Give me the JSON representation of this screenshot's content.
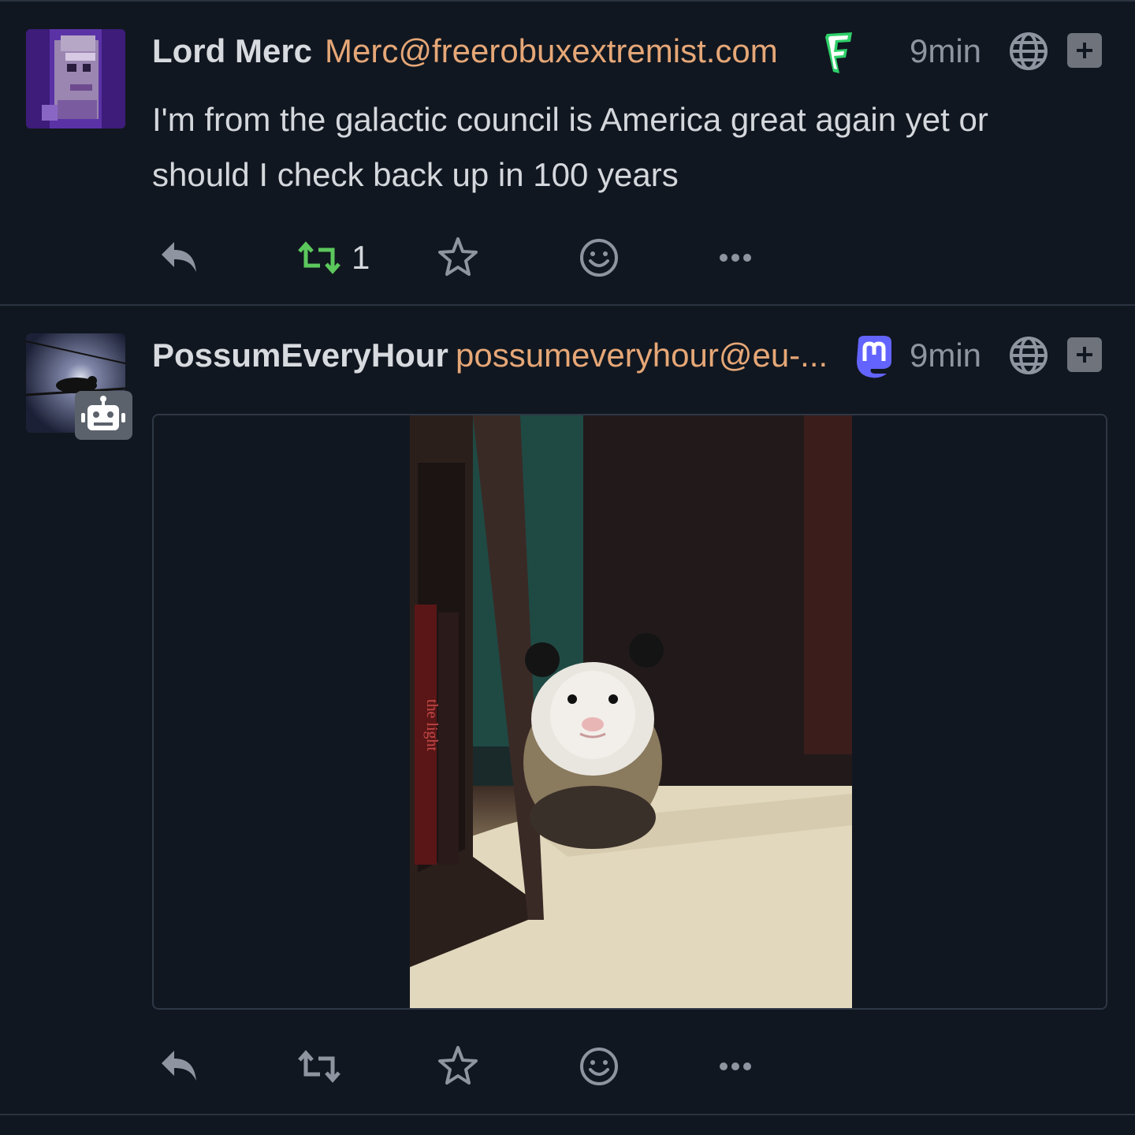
{
  "posts": [
    {
      "display_name": "Lord Merc",
      "handle": "Merc@freerobuxextremist.com",
      "server_icon": "fedi-f-logo-icon",
      "timestamp": "9min",
      "visibility_icon": "globe-icon",
      "content": "I'm from the galactic council is America great again yet or should I check back up in 100 years",
      "boost_count": "1",
      "boosted": true,
      "accent_boost_color": "#5cc85c"
    },
    {
      "display_name": "PossumEveryHour",
      "handle": "possumeveryhour@eu-...",
      "server_icon": "mastodon-logo-icon",
      "timestamp": "9min",
      "visibility_icon": "globe-icon",
      "bot_badge_icon": "robot-icon",
      "media": {
        "type": "image",
        "alt_description_icon": "possum-photo"
      },
      "book_spine_text": "the light"
    }
  ],
  "colors": {
    "background": "#111720",
    "handle": "#e6a777",
    "text": "#d4d7dc",
    "muted": "#8e95a0",
    "boost_active": "#5cc85c",
    "mastodon": "#6364ff"
  }
}
